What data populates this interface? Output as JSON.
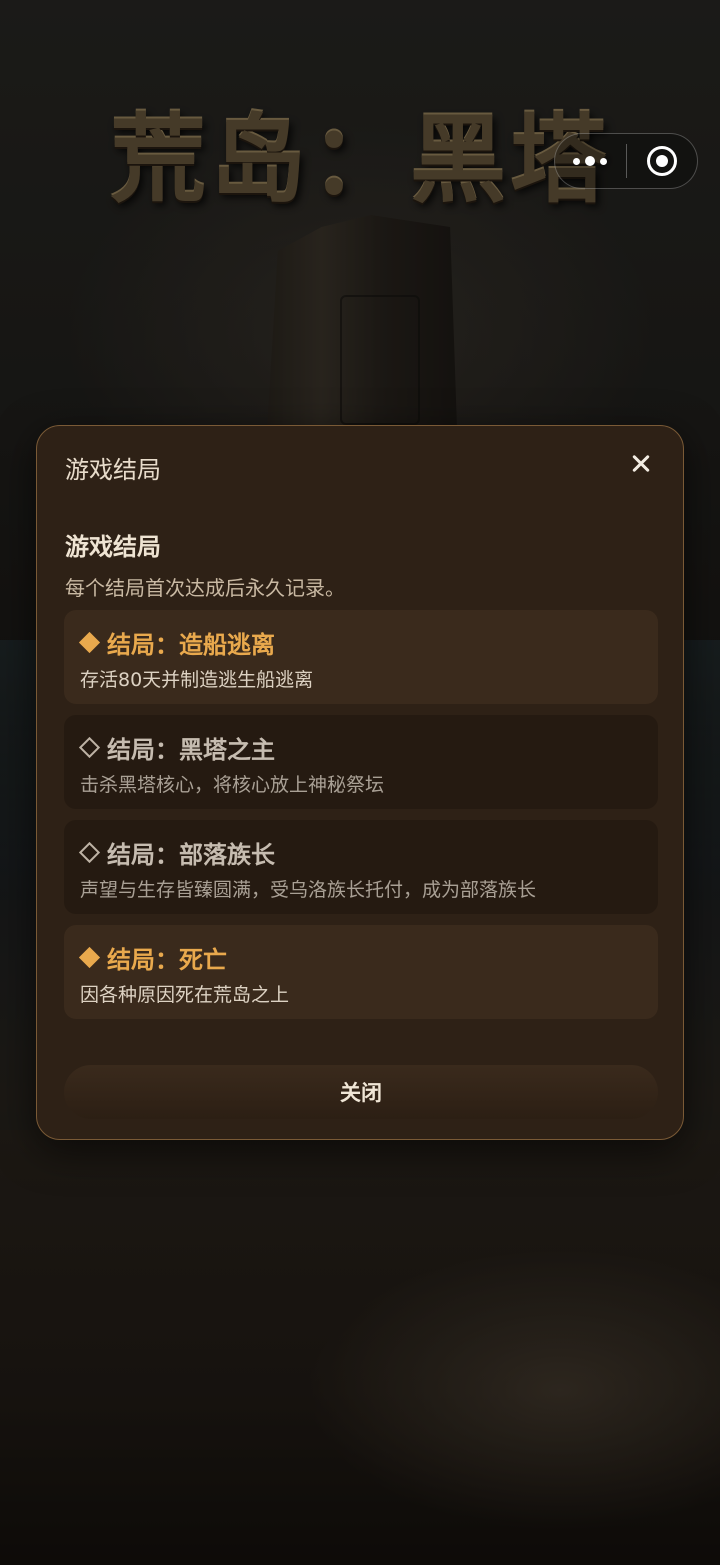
{
  "game": {
    "title": "荒岛：黑塔"
  },
  "capsule": {
    "more_icon": "more-dots-icon",
    "close_icon": "target-circle-icon"
  },
  "modal": {
    "title": "游戏结局",
    "close_icon": "close-x-icon",
    "heading": "游戏结局",
    "description": "每个结局首次达成后永久记录。",
    "endings": [
      {
        "name": "结局：造船逃离",
        "description": "存活80天并制造逃生船逃离",
        "status": "achieved",
        "icon": "filled-diamond-icon"
      },
      {
        "name": "结局：黑塔之主",
        "description": "击杀黑塔核心，将核心放上神秘祭坛",
        "status": "locked",
        "icon": "outline-diamond-icon"
      },
      {
        "name": "结局：部落族长",
        "description": "声望与生存皆臻圆满，受乌洛族长托付，成为部落族长",
        "status": "locked",
        "icon": "outline-diamond-icon"
      },
      {
        "name": "结局：死亡",
        "description": "因各种原因死在荒岛之上",
        "status": "achieved",
        "icon": "filled-diamond-icon"
      }
    ],
    "close_button": "关闭"
  },
  "colors": {
    "accent": "#e9a94d",
    "modal_bg": "#2e2116",
    "modal_border": "#7a5a36"
  }
}
